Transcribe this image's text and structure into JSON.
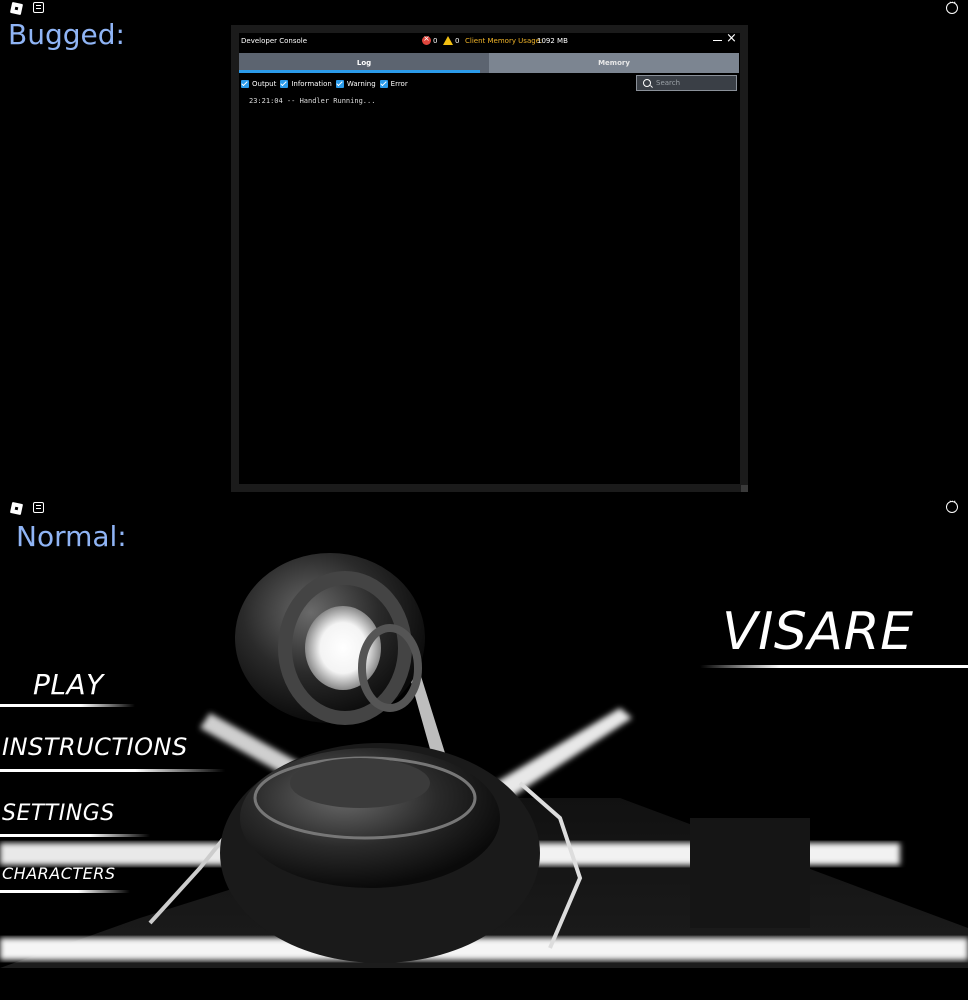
{
  "top": {
    "caption": "Bugged:",
    "icons": [
      "roblox-logo-icon",
      "chat-icon",
      "more-icon"
    ]
  },
  "console": {
    "title": "Developer Console",
    "error_count": "0",
    "warning_count": "0",
    "memory_label": "Client Memory Usage:",
    "memory_value": "1092 MB",
    "tabs": [
      {
        "label": "Log",
        "active": true
      },
      {
        "label": "Memory",
        "active": false
      }
    ],
    "filters": [
      "Output",
      "Information",
      "Warning",
      "Error"
    ],
    "search_placeholder": "Search",
    "log_lines": [
      "23:21:04 -- Handler Running..."
    ]
  },
  "bottom": {
    "caption": "Normal:",
    "game_title": "VISARE",
    "menu": [
      {
        "label": "PLAY"
      },
      {
        "label": "INSTRUCTIONS"
      },
      {
        "label": "SETTINGS"
      },
      {
        "label": "CHARACTERS"
      }
    ]
  },
  "colors": {
    "caption": "#8fb4f5",
    "accent": "#2b9bea",
    "error": "#e0463d",
    "warning": "#f2c012"
  }
}
